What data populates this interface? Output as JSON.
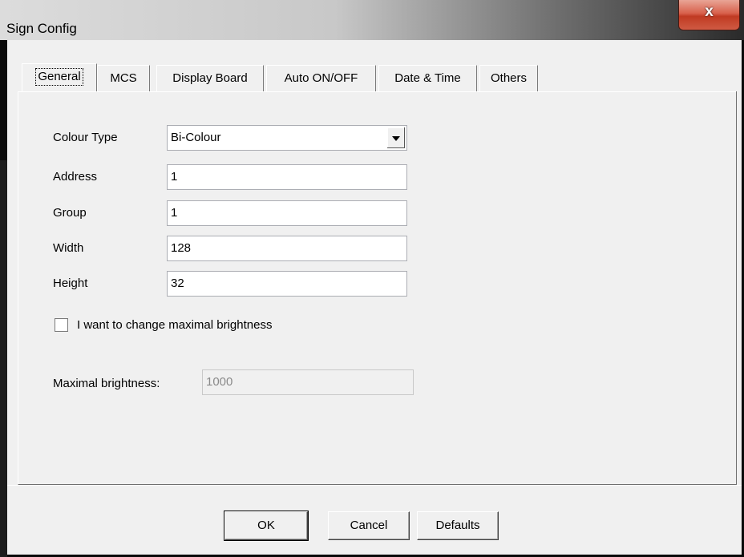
{
  "window": {
    "title": "Sign Config",
    "close_glyph": "x"
  },
  "tabs": [
    {
      "label": "General",
      "selected": true
    },
    {
      "label": "MCS",
      "selected": false
    },
    {
      "label": "Display Board",
      "selected": false
    },
    {
      "label": "Auto ON/OFF",
      "selected": false
    },
    {
      "label": "Date & Time",
      "selected": false
    },
    {
      "label": "Others",
      "selected": false
    }
  ],
  "general": {
    "colour_type": {
      "label": "Colour Type",
      "value": "Bi-Colour"
    },
    "address": {
      "label": "Address",
      "value": "1"
    },
    "group": {
      "label": "Group",
      "value": "1"
    },
    "width": {
      "label": "Width",
      "value": "128"
    },
    "height": {
      "label": "Height",
      "value": "32"
    },
    "brightness_checkbox": {
      "label": "I want to change maximal brightness",
      "checked": false
    },
    "max_brightness": {
      "label": "Maximal brightness:",
      "value": "1000",
      "enabled": false
    }
  },
  "buttons": {
    "ok": "OK",
    "cancel": "Cancel",
    "defaults": "Defaults"
  },
  "colors": {
    "dialog_bg": "#f0f0f0",
    "close_button": "#c8432b"
  }
}
